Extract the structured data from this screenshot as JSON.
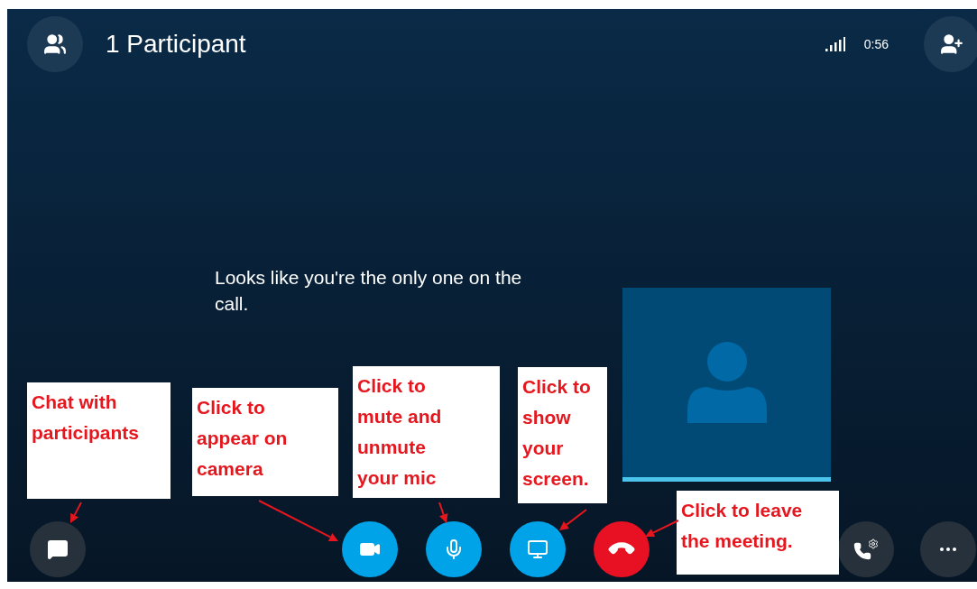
{
  "call": {
    "title": "1 Participant",
    "duration": "0:56",
    "message": "Looks like you're the only one on the call."
  },
  "controls": [
    {
      "kind": "chat"
    },
    {
      "kind": "video"
    },
    {
      "kind": "mic"
    },
    {
      "kind": "share"
    },
    {
      "kind": "hangup"
    },
    {
      "kind": "dialpad"
    },
    {
      "kind": "more"
    }
  ],
  "annotations": [
    {
      "lines": [
        "Chat with",
        "participants"
      ]
    },
    {
      "lines": [
        "Click to",
        "appear on",
        "camera"
      ]
    },
    {
      "lines": [
        "Click to",
        "mute and",
        "unmute",
        "your mic"
      ]
    },
    {
      "lines": [
        "Click to",
        "show",
        "your",
        "screen."
      ]
    },
    {
      "lines": [
        "Click to leave",
        "the meeting."
      ]
    }
  ]
}
